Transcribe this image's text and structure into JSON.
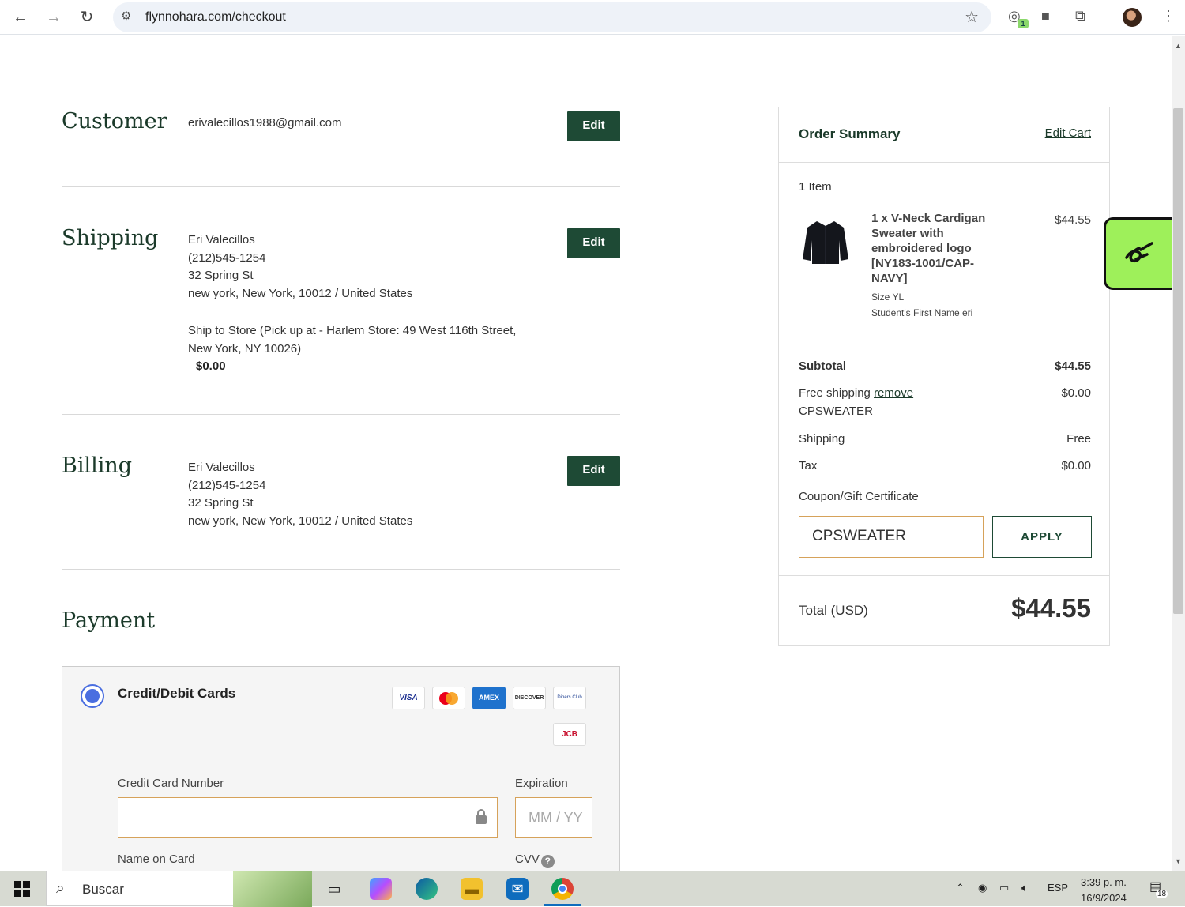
{
  "browser": {
    "url": "flynnohara.com/checkout",
    "extension_badge": "1"
  },
  "customer": {
    "title": "Customer",
    "email": "erivalecillos1988@gmail.com",
    "edit_label": "Edit"
  },
  "shipping": {
    "title": "Shipping",
    "name": "Eri Valecillos",
    "phone": "(212)545-1254",
    "street": "32 Spring St",
    "city_line": "new york, New York, 10012 / United States",
    "method_line1": "Ship to Store (Pick up at - Harlem Store: 49 West 116th Street,",
    "method_line2": "New York, NY 10026)",
    "method_price": "$0.00",
    "edit_label": "Edit"
  },
  "billing": {
    "title": "Billing",
    "name": "Eri Valecillos",
    "phone": "(212)545-1254",
    "street": "32 Spring St",
    "city_line": "new york, New York, 10012 / United States",
    "edit_label": "Edit"
  },
  "payment": {
    "title": "Payment",
    "method_label": "Credit/Debit Cards",
    "cards": [
      "VISA",
      "mastercard",
      "AMEX",
      "DISCOVER",
      "Diners Club",
      "JCB"
    ],
    "card_number_label": "Credit Card Number",
    "expiration_label": "Expiration",
    "expiration_placeholder": "MM / YY",
    "name_on_card_label": "Name on Card",
    "cvv_label": "CVV",
    "help_glyph": "?"
  },
  "summary": {
    "title": "Order Summary",
    "edit_cart": "Edit Cart",
    "items_count": "1 Item",
    "product_name": "1 x V-Neck Cardigan Sweater with embroidered logo [NY183-1001/CAP-NAVY]",
    "product_price": "$44.55",
    "product_size": "Size YL",
    "product_student": "Student's First Name eri",
    "subtotal_label": "Subtotal",
    "subtotal_value": "$44.55",
    "free_shipping_label": "Free shipping",
    "remove_label": "remove",
    "coupon_code": "CPSWEATER",
    "free_shipping_value": "$0.00",
    "shipping_label": "Shipping",
    "shipping_value": "Free",
    "tax_label": "Tax",
    "tax_value": "$0.00",
    "coupon_label": "Coupon/Gift Certificate",
    "coupon_input_value": "CPSWEATER",
    "apply_label": "APPLY",
    "total_label": "Total (USD)",
    "total_value": "$44.55"
  },
  "taskbar": {
    "search_text": "Buscar",
    "language": "ESP",
    "time": "3:39 p. m.",
    "date": "16/9/2024",
    "notifications": "18"
  },
  "colors": {
    "brand_green": "#1e4a35",
    "accent_blue": "#4a6ee0",
    "widget_green": "#9ef05a"
  }
}
